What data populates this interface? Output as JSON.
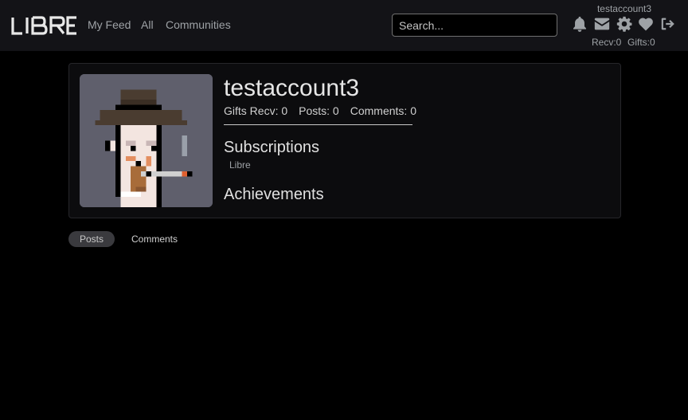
{
  "brand": {
    "logo_text": "LIBRE"
  },
  "nav": {
    "links": [
      "My Feed",
      "All",
      "Communities"
    ]
  },
  "search": {
    "placeholder": "Search..."
  },
  "user_menu": {
    "username": "testaccount3",
    "recv_label": "Recv:0",
    "gifts_label": "Gifts:0",
    "icons": [
      "bell-icon",
      "envelope-icon",
      "gear-icon",
      "heart-icon",
      "sign-out-icon"
    ]
  },
  "profile": {
    "username": "testaccount3",
    "stats": {
      "gifts_recv": "Gifts Recv: 0",
      "posts": "Posts: 0",
      "comments": "Comments: 0"
    },
    "subscriptions_title": "Subscriptions",
    "subscriptions": [
      "Libre"
    ],
    "achievements_title": "Achievements",
    "avatar_bg_color": "#5f5f6c"
  },
  "tabs": [
    {
      "label": "Posts",
      "active": true
    },
    {
      "label": "Comments",
      "active": false
    }
  ],
  "colors": {
    "navbar_bg": "#131317",
    "page_bg": "#000000",
    "muted_text": "#9ea2a6"
  }
}
